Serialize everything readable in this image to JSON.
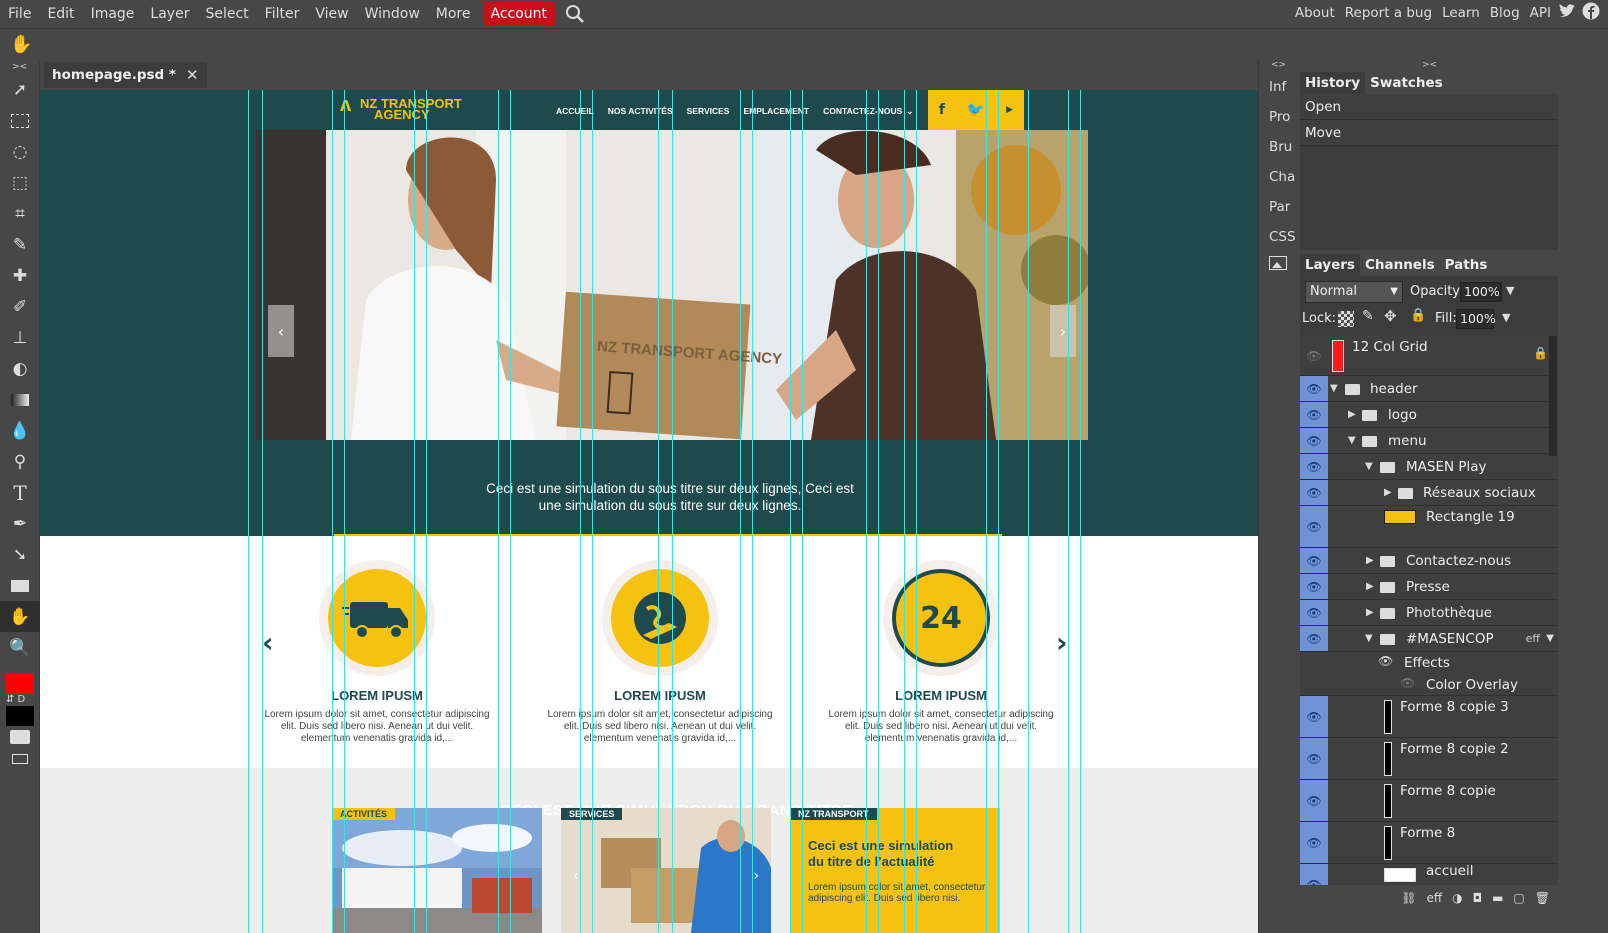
{
  "menubar": {
    "items": [
      "File",
      "Edit",
      "Image",
      "Layer",
      "Select",
      "Filter",
      "View",
      "Window",
      "More"
    ],
    "account": "Account",
    "right_items": [
      "About",
      "Report a bug",
      "Learn",
      "Blog",
      "API"
    ]
  },
  "document": {
    "tab_title": "homepage.psd *"
  },
  "side_strip": [
    "Inf",
    "Pro",
    "Bru",
    "Cha",
    "Par",
    "CSS"
  ],
  "history_panel": {
    "tabs": [
      "History",
      "Swatches"
    ],
    "rows": [
      "Open",
      "Move"
    ]
  },
  "layers_panel": {
    "tabs": [
      "Layers",
      "Channels",
      "Paths"
    ],
    "blend_mode": "Normal",
    "opacity_label": "Opacity:",
    "opacity_value": "100%",
    "lock_label": "Lock:",
    "fill_label": "Fill:",
    "fill_value": "100%",
    "layers": [
      {
        "name": "12 Col Grid"
      },
      {
        "name": "header"
      },
      {
        "name": "logo"
      },
      {
        "name": "menu"
      },
      {
        "name": "MASEN Play"
      },
      {
        "name": "Réseaux sociaux"
      },
      {
        "name": "Rectangle 19"
      },
      {
        "name": "Contactez-nous"
      },
      {
        "name": "Presse"
      },
      {
        "name": "Photothèque"
      },
      {
        "name": "#MASENCOP",
        "badge": "eff"
      },
      {
        "name": "Effects"
      },
      {
        "name": "Color Overlay"
      },
      {
        "name": "Forme 8 copie 3"
      },
      {
        "name": "Forme 8 copie 2"
      },
      {
        "name": "Forme 8 copie"
      },
      {
        "name": "Forme 8"
      },
      {
        "name": "accueil"
      }
    ],
    "footer": "eff"
  },
  "site": {
    "logo_line1": "NZ TRANSPORT",
    "logo_line2": "AGENCY",
    "nav": [
      "ACCUEIL",
      "NOS ACTIVITÉS",
      "SERVICES",
      "EMPLACEMENT",
      "CONTACTEZ-NOUS"
    ],
    "hero_box_text": "NZ TRANSPORT AGENCY",
    "subtitle": "Ceci est une simulation du sous titre sur deux lignes, Ceci est une simulation du sous titre sur deux lignes.",
    "features": [
      {
        "icon": "truck-icon",
        "title": "LOREM IPUSM",
        "text": "Lorem ipsum dolor sit amet, consectetur adipiscing elit. Duis sed libero nisi. Aenean ut dui velit. elementum venenatis gravida id,..."
      },
      {
        "icon": "plane-globe-icon",
        "title": "LOREM IPUSM",
        "text": "Lorem ipsum dolor sit amet, consectetur adipiscing elit. Duis sed libero nisi. Aenean ut dui velit. elementum venenatis gravida id,..."
      },
      {
        "icon": "24h-icon",
        "title": "LOREM IPUSM",
        "text": "Lorem ipsum dolor sit amet, consectetur adipiscing elit. Duis sed libero nisi. Aenean ut dui velit. elementum venenatis gravida id,..."
      }
    ],
    "feature_24": "24",
    "grand_title": "CECI EST UNE SIMULATION DU GRAND TITRE",
    "cards": [
      {
        "tag": "ACTIVITÉS"
      },
      {
        "tag": "SERVICES"
      },
      {
        "tag": "NZ TRANSPORT",
        "headline": "Ceci est une simulation du titre de l’actualité",
        "text": "Lorem ipsum color sit amet, consectetur adipiscing elit. Duis sed libero nisi."
      }
    ]
  },
  "colors": {
    "accent_red": "#c8101b",
    "site_teal": "#1f4a4d",
    "site_yellow": "#f5c20f",
    "guide_cyan": "#38e3e3",
    "layer_eye_blue": "#6f93d6"
  }
}
